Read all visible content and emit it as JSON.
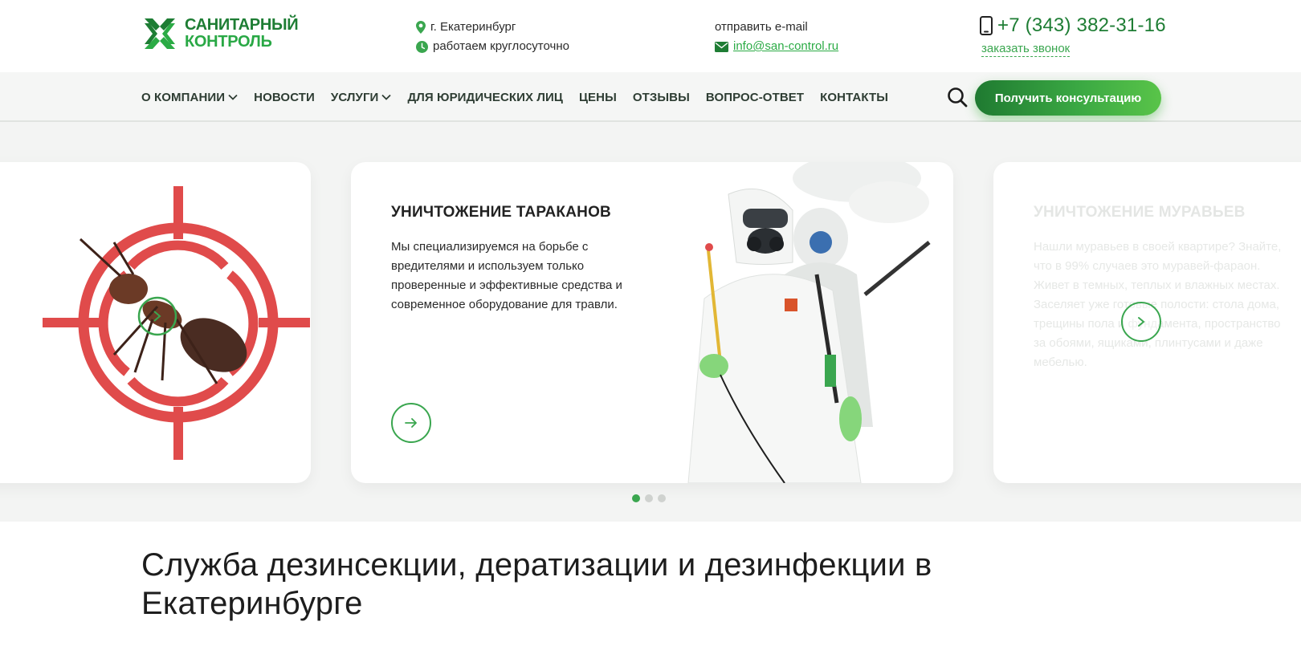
{
  "header": {
    "logo": {
      "line1": "САНИТАРНЫЙ",
      "line2": "КОНТРОЛЬ"
    },
    "city": "г. Екатеринбург",
    "hours": "работаем круглосуточно",
    "email_label": "отправить e-mail",
    "email": "info@san-control.ru",
    "phone": "+7 (343) 382-31-16",
    "callback": "заказать звонок"
  },
  "nav": {
    "items": [
      {
        "label": "О КОМПАНИИ",
        "dropdown": true
      },
      {
        "label": "НОВОСТИ",
        "dropdown": false
      },
      {
        "label": "УСЛУГИ",
        "dropdown": true
      },
      {
        "label": "ДЛЯ ЮРИДИЧЕСКИХ ЛИЦ",
        "dropdown": false
      },
      {
        "label": "ЦЕНЫ",
        "dropdown": false
      },
      {
        "label": "ОТЗЫВЫ",
        "dropdown": false
      },
      {
        "label": "ВОПРОС-ОТВЕТ",
        "dropdown": false
      },
      {
        "label": "КОНТАКТЫ",
        "dropdown": false
      }
    ],
    "consult_button": "Получить консультацию"
  },
  "slider": {
    "active_slide": {
      "title": "УНИЧТОЖЕНИЕ ТАРАКАНОВ",
      "text": "Мы специализируемся на борьбе с вредителями и используем только проверенные и эффективные средства и современное оборудование для травли."
    },
    "next_slide": {
      "title": "УНИЧТОЖЕНИЕ МУРАВЬЕВ",
      "text": "Нашли муравьев в своей квартире? Знайте, что в 99% случаев это муравей-фараон. Живет в темных, теплых и влажных местах. Заселяет уже готовые полости: стола дома, трещины пола и фундамента, пространство за обоями, ящиками, плинтусами и даже мебелью."
    },
    "dots_count": 3,
    "active_dot": 1
  },
  "page": {
    "heading": "Служба дезинсекции, дератизации и дезинфекции в Екатеринбурге"
  },
  "colors": {
    "brand_green": "#2bab45",
    "dark_green": "#1e7d34",
    "target_red": "#e04b4b"
  },
  "icons": [
    "logo-mark-icon",
    "location-pin-icon",
    "clock-icon",
    "envelope-icon",
    "mobile-phone-icon",
    "chevron-down-icon",
    "search-icon",
    "arrow-right-icon",
    "chevron-right-icon"
  ]
}
